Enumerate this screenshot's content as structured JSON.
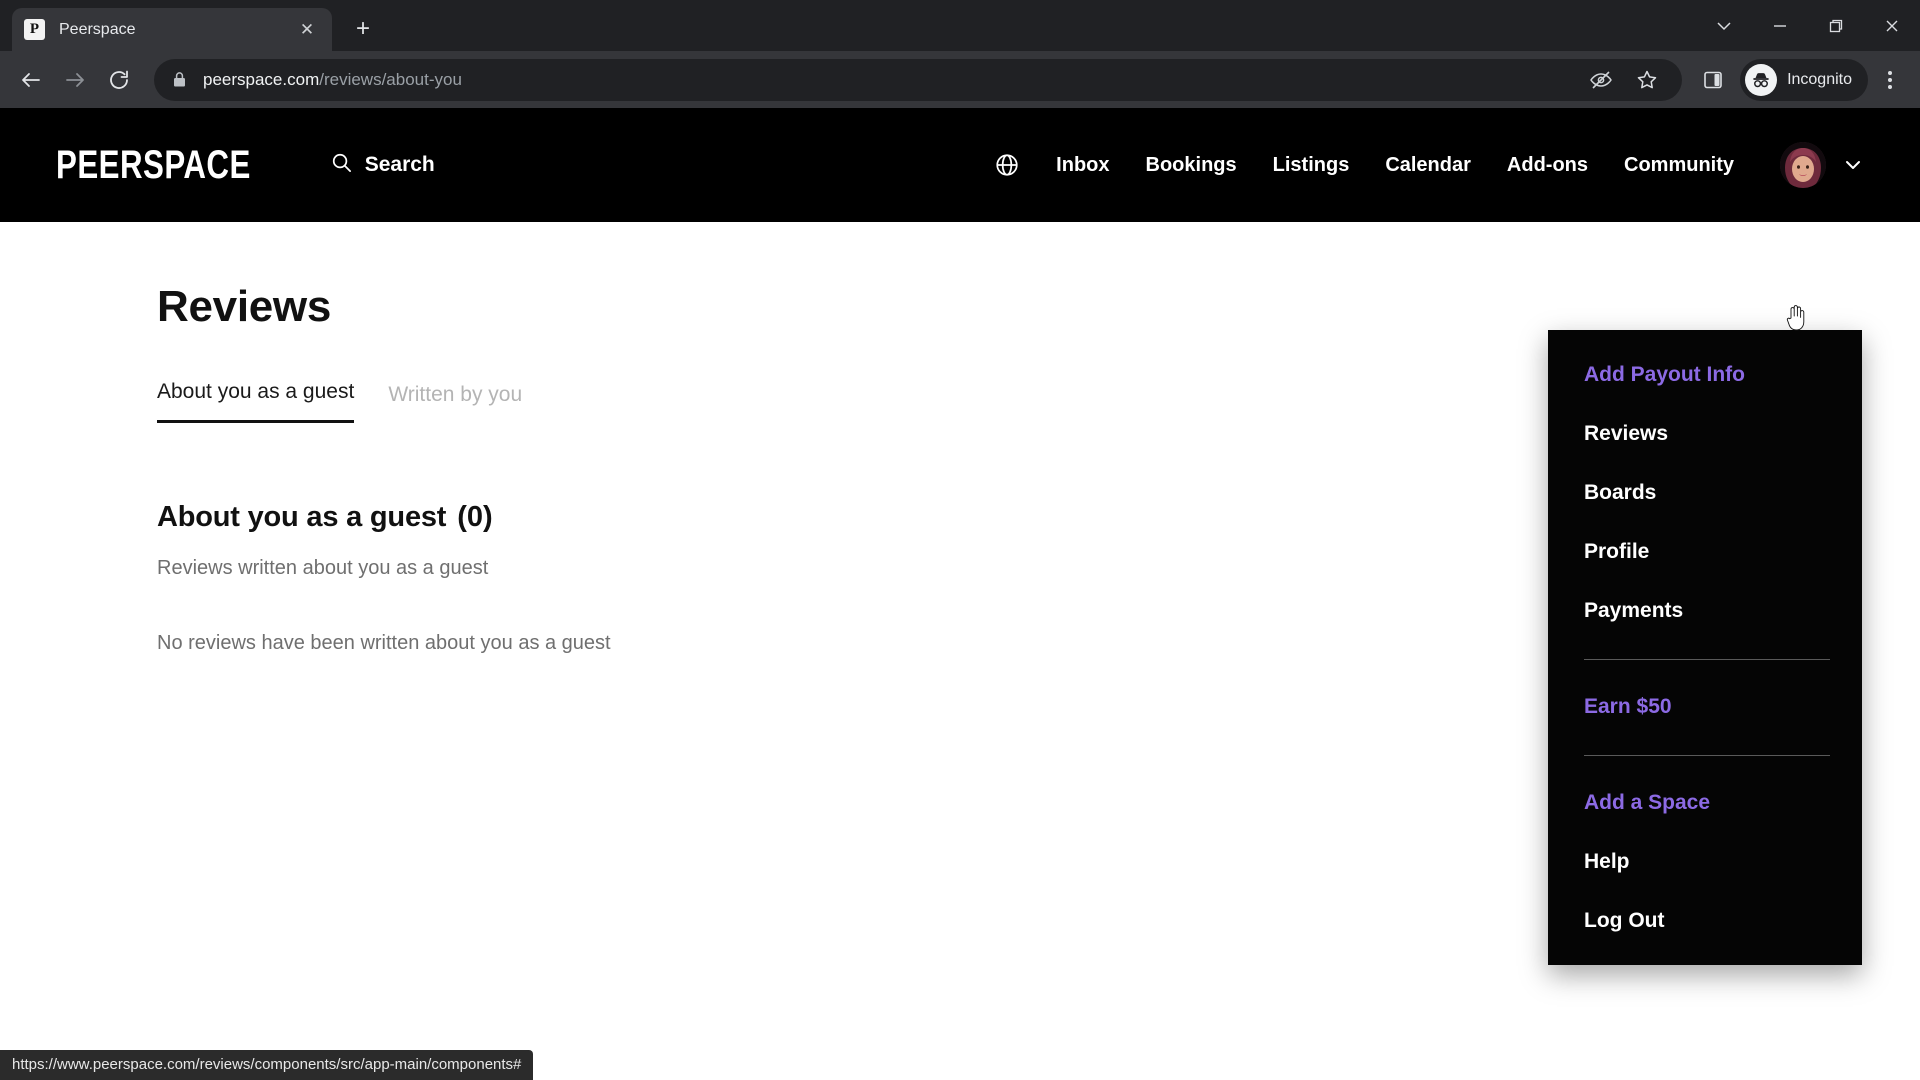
{
  "browser": {
    "tab": {
      "title": "Peerspace",
      "favicon_letter": "P",
      "close_label": "✕"
    },
    "newtab_label": "+",
    "window_controls": {
      "minimize": "—",
      "restore": "restore-icon",
      "close": "✕",
      "collapse": "chevron-down-icon"
    },
    "url": {
      "domain": "peerspace.com",
      "path": "/reviews/about-you"
    },
    "profile_label": "Incognito",
    "icons": [
      "back-icon",
      "forward-icon",
      "reload-icon",
      "lock-icon",
      "tracking-protection-icon",
      "bookmark-star-icon",
      "side-panel-icon",
      "incognito-icon",
      "browser-menu-icon"
    ]
  },
  "site_header": {
    "logo": "PEERSPACE",
    "search_label": "Search",
    "nav": [
      {
        "label": "Inbox"
      },
      {
        "label": "Bookings"
      },
      {
        "label": "Listings"
      },
      {
        "label": "Calendar"
      },
      {
        "label": "Add-ons"
      },
      {
        "label": "Community"
      }
    ]
  },
  "dropdown": {
    "accent_color": "#8c6ae4",
    "items": [
      {
        "label": "Add Payout Info",
        "accent": true
      },
      {
        "label": "Reviews",
        "accent": false
      },
      {
        "label": "Boards",
        "accent": false
      },
      {
        "label": "Profile",
        "accent": false
      },
      {
        "label": "Payments",
        "accent": false
      },
      {
        "label": "Earn $50",
        "accent": true
      },
      {
        "label": "Add a Space",
        "accent": true
      },
      {
        "label": "Help",
        "accent": false
      },
      {
        "label": "Log Out",
        "accent": false
      }
    ]
  },
  "main": {
    "page_title": "Reviews",
    "tabs": [
      {
        "label": "About you as a guest",
        "active": true
      },
      {
        "label": "Written by you",
        "active": false
      }
    ],
    "section_title": "About you as a guest",
    "section_count": "(0)",
    "section_subtitle": "Reviews written about you as a guest",
    "empty_message": "No reviews have been written about you as a guest"
  },
  "status_bar": {
    "url": "https://www.peerspace.com/reviews/components/src/app-main/components#"
  }
}
